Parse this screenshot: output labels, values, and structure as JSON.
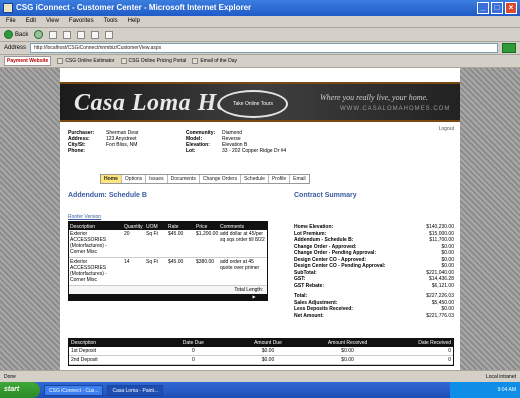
{
  "window": {
    "title": "CSG iConnect - Customer Center - Microsoft Internet Explorer",
    "controls": [
      "_",
      "□",
      "×"
    ]
  },
  "menu": [
    "File",
    "Edit",
    "View",
    "Favorites",
    "Tools",
    "Help"
  ],
  "toolbar": {
    "back": "Back",
    "forward": "",
    "stop": "",
    "refresh": "",
    "home": ""
  },
  "address": {
    "label": "Address",
    "url": "http://localhost/CSGiConnect/nnmbiz/CustomerView.aspx"
  },
  "links": {
    "selector": "Payment Website",
    "items": [
      "CSG Online Estimator",
      "CSG Online Pricing Portal",
      "Email of the Day"
    ]
  },
  "header": {
    "logo": "Casa Loma Homes",
    "tour_button": "Take Online Tours",
    "tagline": "Where you really live, your home.",
    "website": "WWW.CASALOMAHOMES.COM",
    "logout": "Logout"
  },
  "info": {
    "left": [
      {
        "label": "Purchaser:",
        "value": "Sherman Dear"
      },
      {
        "label": "Address:",
        "value": "123 Anystreet"
      },
      {
        "label": "City/St:",
        "value": "Fort Bliss, NM"
      },
      {
        "label": "Phone:",
        "value": ""
      }
    ],
    "right": [
      {
        "label": "Community:",
        "value": "Diamond"
      },
      {
        "label": "Model:",
        "value": "Reverse"
      },
      {
        "label": "Elevation:",
        "value": "Elevation B"
      },
      {
        "label": "Lot:",
        "value": "33 - 202 Copper Ridge Dr #4"
      }
    ]
  },
  "tabs": [
    "Home",
    "Options",
    "Issues",
    "Documents",
    "Change Orders",
    "Schedule",
    "Profile",
    "Email"
  ],
  "addendum": {
    "title": "Addendum: Schedule B",
    "link": "Roofer Version",
    "columns": [
      "Description",
      "Quantity",
      "UOM",
      "Rate",
      "Price",
      "Comments"
    ],
    "rows": [
      {
        "desc": "Exterior ACCESSORIES (Motorfactures) - Corner Misc",
        "qty": "20",
        "uom": "Sq Ft",
        "rate": "$45.00",
        "price": "$1,200.00",
        "comments": "add dollar at 45/per sq sqs order till 8/22"
      },
      {
        "desc": "Exterior ACCESSORIES (Motorfactures) - Corner Misc",
        "qty": "14",
        "uom": "Sq Ft",
        "rate": "$45.00",
        "price": "$380.00",
        "comments": "add order at 45 quote over primer"
      }
    ],
    "footer_text": "Total Length:"
  },
  "summary": {
    "title": "Contract Summary",
    "rows": [
      {
        "label": "Home Elevation:",
        "value": "$140,230.00"
      },
      {
        "label": "Lot Premium:",
        "value": "$15,000.00"
      },
      {
        "label": "Addendum - Schedule B:",
        "value": "$11,700.00"
      },
      {
        "label": "Change Order - Approved:",
        "value": "$0.00"
      },
      {
        "label": "Change Order - Pending Approval:",
        "value": "$0.00"
      },
      {
        "label": "Design Center CO - Approved:",
        "value": "$0.00"
      },
      {
        "label": "Design Center CO - Pending Approval:",
        "value": "$0.00"
      },
      {
        "label": "SubTotal:",
        "value": "$221,040.00"
      },
      {
        "label": "GST:",
        "value": "$14,436.28"
      },
      {
        "label": "GST Rebate:",
        "value": "$6,121.00"
      },
      {
        "label": "",
        "value": ""
      },
      {
        "label": "Total:",
        "value": "$227,226.03"
      },
      {
        "label": "Sales Adjustment:",
        "value": "$5,450.00"
      },
      {
        "label": "Less Deposits Received:",
        "value": "$0.00"
      },
      {
        "label": "Net Amount:",
        "value": "$221,776.03"
      }
    ]
  },
  "deposits": {
    "columns": [
      "Description",
      "Date Due",
      "Amount Due",
      "Amount Received",
      "Date Received"
    ],
    "rows": [
      {
        "desc": "1st Deposit",
        "date_due": "0",
        "amount_due": "$0.00",
        "received": "$0.00",
        "date_received": "0"
      },
      {
        "desc": "2nd Deposit",
        "date_due": "0",
        "amount_due": "$0.00",
        "received": "$0.00",
        "date_received": "0"
      }
    ]
  },
  "status": {
    "left": "Done",
    "right": "Local intranet"
  },
  "taskbar": {
    "start": "start",
    "items": [
      "CSG iConnect - Cus...",
      "Casa Loma - Paint..."
    ],
    "clock": "9:04 AM"
  }
}
